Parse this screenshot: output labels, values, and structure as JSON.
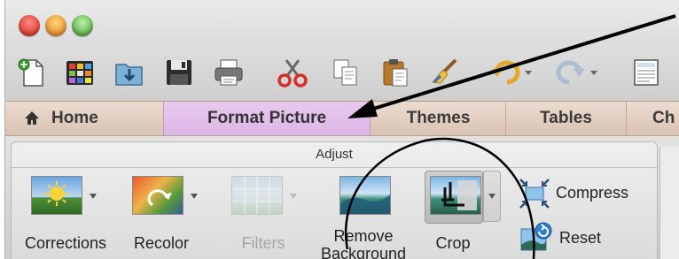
{
  "toolbar": {
    "icons": [
      "new-document-icon",
      "gallery-icon",
      "open-folder-icon",
      "save-icon",
      "print-icon",
      "cut-icon",
      "copy-icon",
      "paste-icon",
      "format-painter-icon",
      "undo-icon",
      "redo-icon",
      "document-icon"
    ]
  },
  "tabs": [
    {
      "label": "Home"
    },
    {
      "label": "Format Picture"
    },
    {
      "label": "Themes"
    },
    {
      "label": "Tables"
    },
    {
      "label": "Ch"
    }
  ],
  "ribbon": {
    "group_title": "Adjust",
    "buttons": {
      "corrections": "Corrections",
      "recolor": "Recolor",
      "filters": "Filters",
      "remove_background_line1": "Remove",
      "remove_background_line2": "Background",
      "crop": "Crop",
      "compress": "Compress",
      "reset": "Reset"
    }
  },
  "colors": {
    "active_tab": "#dcb6e6",
    "tab_bar": "#e3cfc0",
    "close_light": "#e0443e",
    "minimize_light": "#e9a13b",
    "zoom_light": "#62c554"
  }
}
